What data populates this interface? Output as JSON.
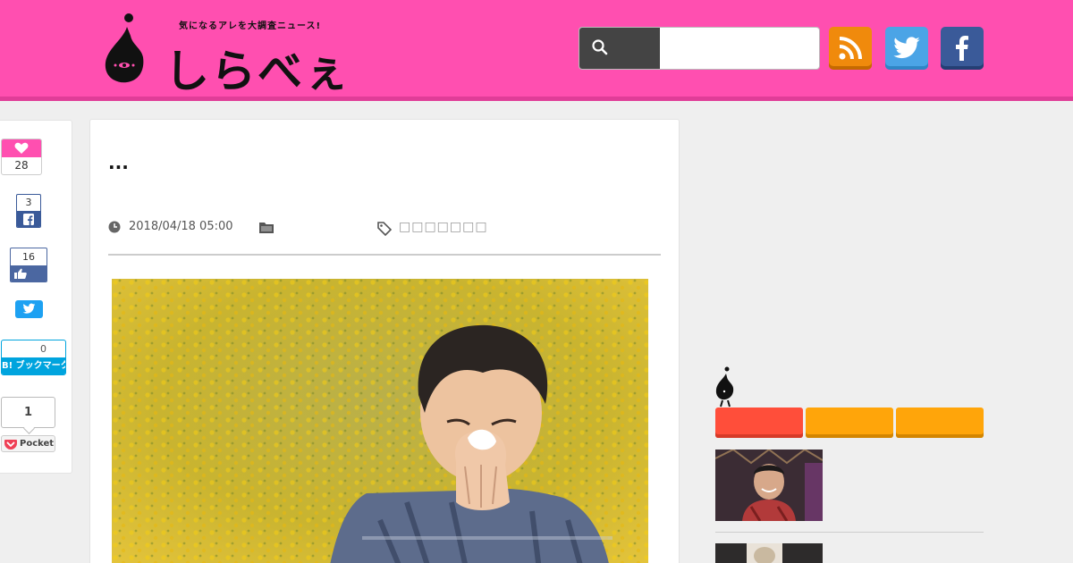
{
  "header": {
    "tagline": "気になるアレを大調査ニュース!",
    "brand": "しらべぇ",
    "search": {
      "placeholder": "",
      "value": ""
    },
    "social": [
      "rss-icon",
      "twitter-icon",
      "facebook-icon"
    ],
    "colors": {
      "header_bg": "#ff4fb0",
      "rss": "#f08a0c",
      "twitter": "#4ba4e6",
      "facebook": "#3a5a99"
    }
  },
  "share": {
    "like_count": "28",
    "fb_share_count": "3",
    "fb_like_count": "16",
    "hatena_count": "0",
    "hatena_label": "B! ブックマーク",
    "pocket_count": "1",
    "pocket_label": "Pocket"
  },
  "article": {
    "title": "...",
    "date": "2018/04/18 05:00",
    "tags": "□□□□□□□",
    "hero_alt": "boy sneezing in yellow flower field"
  },
  "sidebar": {
    "tab_colors": [
      "#ff4e3a",
      "#ffa50a",
      "#ffa50a"
    ]
  }
}
